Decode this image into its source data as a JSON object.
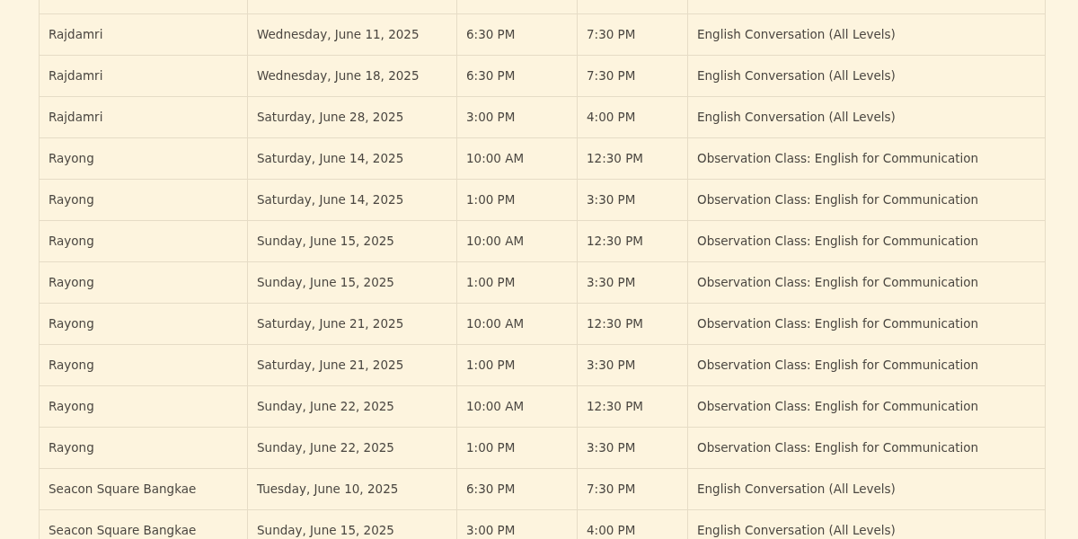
{
  "table": {
    "rows": [
      [
        "Rajdamri",
        "Wednesday, June 11, 2025",
        "6:30 PM",
        "7:30 PM",
        "English Conversation (All Levels)"
      ],
      [
        "Rajdamri",
        "Wednesday, June 18, 2025",
        "6:30 PM",
        "7:30 PM",
        "English Conversation (All Levels)"
      ],
      [
        "Rajdamri",
        "Saturday, June 28, 2025",
        "3:00 PM",
        "4:00 PM",
        "English Conversation (All Levels)"
      ],
      [
        "Rayong",
        "Saturday, June 14, 2025",
        "10:00 AM",
        "12:30 PM",
        "Observation Class: English for Communication"
      ],
      [
        "Rayong",
        "Saturday, June 14, 2025",
        "1:00 PM",
        "3:30 PM",
        "Observation Class: English for Communication"
      ],
      [
        "Rayong",
        "Sunday, June 15, 2025",
        "10:00 AM",
        "12:30 PM",
        "Observation Class: English for Communication"
      ],
      [
        "Rayong",
        "Sunday, June 15, 2025",
        "1:00 PM",
        "3:30 PM",
        "Observation Class: English for Communication"
      ],
      [
        "Rayong",
        "Saturday, June 21, 2025",
        "10:00 AM",
        "12:30 PM",
        "Observation Class: English for Communication"
      ],
      [
        "Rayong",
        "Saturday, June 21, 2025",
        "1:00 PM",
        "3:30 PM",
        "Observation Class: English for Communication"
      ],
      [
        "Rayong",
        "Sunday, June 22, 2025",
        "10:00 AM",
        "12:30 PM",
        "Observation Class: English for Communication"
      ],
      [
        "Rayong",
        "Sunday, June 22, 2025",
        "1:00 PM",
        "3:30 PM",
        "Observation Class: English for Communication"
      ],
      [
        "Seacon Square Bangkae",
        "Tuesday, June 10, 2025",
        "6:30 PM",
        "7:30 PM",
        "English Conversation (All Levels)"
      ],
      [
        "Seacon Square Bangkae",
        "Sunday, June 15, 2025",
        "3:00 PM",
        "4:00 PM",
        "English Conversation (All Levels)"
      ]
    ]
  }
}
